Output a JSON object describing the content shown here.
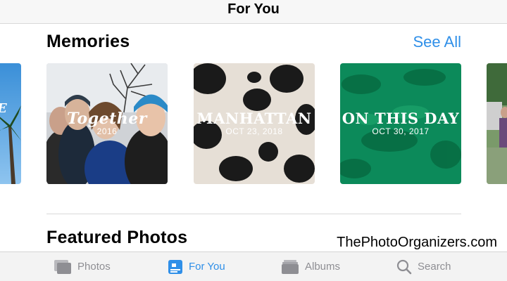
{
  "header": {
    "title": "For You"
  },
  "memories": {
    "title": "Memories",
    "see_all": "See All",
    "cards": [
      {
        "title": "Together",
        "date": "2016"
      },
      {
        "title": "MANHATTAN",
        "date": "OCT 23, 2018"
      },
      {
        "title": "ON THIS DAY",
        "date": "OCT 30, 2017"
      }
    ]
  },
  "featured": {
    "title": "Featured Photos"
  },
  "watermark": "ThePhotoOrganizers.com",
  "tabs": [
    {
      "label": "Photos",
      "icon": "photos-icon",
      "active": false
    },
    {
      "label": "For You",
      "icon": "for-you-icon",
      "active": true
    },
    {
      "label": "Albums",
      "icon": "albums-icon",
      "active": false
    },
    {
      "label": "Search",
      "icon": "search-icon",
      "active": false
    }
  ],
  "colors": {
    "accent": "#2f8fe8",
    "inactive": "#8e8e93"
  }
}
